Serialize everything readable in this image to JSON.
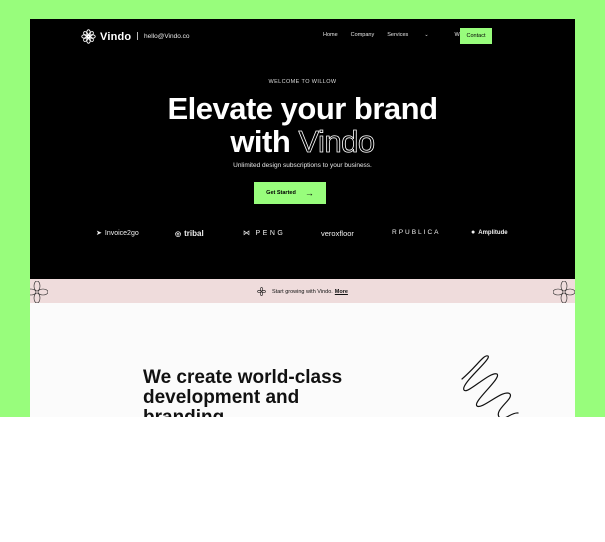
{
  "nav": {
    "logo": "Vindo",
    "email": "hello@Vindo.co",
    "menu": [
      "Home",
      "Company",
      "Services",
      "Works"
    ],
    "contact": "Contact"
  },
  "hero": {
    "eyebrow": "WELCOME TO WILLOW",
    "title_line1": "Elevate your brand",
    "title_with": "with",
    "title_brand": "Vindo",
    "subtitle": "Unlimited design subscriptions to your business.",
    "cta": "Get Started"
  },
  "brands": [
    "Invoice2go",
    "tribal",
    "PENG",
    "veroxfloor",
    "RPUBLICA",
    "Amplitude"
  ],
  "banner": {
    "text": "Start growing with Vindo.",
    "link": "More"
  },
  "section": {
    "heading": "We create world-class development and branding"
  },
  "colors": {
    "accent": "#98fd7c",
    "hero_bg": "#000000",
    "banner_bg": "#efdcdc"
  }
}
